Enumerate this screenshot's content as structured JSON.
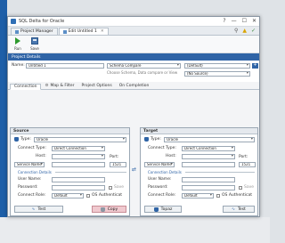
{
  "window": {
    "title": "SQL Delta for Oracle"
  },
  "controls": {
    "help": "?",
    "minimize": "—",
    "maximize": "☐",
    "close": "✕"
  },
  "doc_tabs": [
    {
      "label": "Project Manager",
      "close": ""
    },
    {
      "label": "Edit Untitled 1",
      "close": "✕"
    }
  ],
  "header_icons": {
    "pin": "⚲",
    "warning": "▲",
    "ok": "✓"
  },
  "toolbar": {
    "run_label": "Run",
    "save_label": "Save"
  },
  "project_details": {
    "title": "Project Details",
    "name_label": "Name:",
    "name_value": "Untitled 1",
    "compare_mode": "Schema Compare",
    "compare_hint": "Choose Schema, Data compare or View",
    "profile": "(Default)",
    "secondary": "(No Source)",
    "add": "+"
  },
  "config_tabs": [
    {
      "label": "Connection"
    },
    {
      "label": "Map & Filter"
    },
    {
      "label": "Project Options"
    },
    {
      "label": "On Completion"
    }
  ],
  "source": {
    "title": "Source",
    "type_label": "Type:",
    "type_value": "Oracle",
    "connect_type_label": "Connect Type:",
    "connect_type_value": "Direct Connection",
    "host_label": "Host:",
    "host_value": "",
    "port_label": "Port:",
    "port_value": "1521",
    "service_value": "Service Name",
    "conn_details": "Connection Details",
    "user_label": "User Name:",
    "user_value": "",
    "password_label": "Password:",
    "password_value": "",
    "save_label": "Save",
    "role_label": "Connect Role:",
    "role_value": "Default",
    "os_auth_label": "OS Authenticat",
    "test_label": "Test",
    "copy_label": "Copy"
  },
  "swap": {
    "icon": "⇄"
  },
  "target": {
    "title": "Target",
    "type_label": "Type:",
    "type_value": "Oracle",
    "connect_type_label": "Connect Type:",
    "connect_type_value": "Direct Connection",
    "host_label": "Host:",
    "host_value": "",
    "port_label": "Port:",
    "port_value": "1521",
    "service_value": "Service Name",
    "conn_details": "Connection Details",
    "user_label": "User Name:",
    "user_value": "",
    "password_label": "Password:",
    "password_value": "",
    "save_label": "Save",
    "role_label": "Connect Role:",
    "role_value": "Default",
    "os_auth_label": "OS Authenticat",
    "topaz_label": "Topaz",
    "test_label": "Test"
  }
}
